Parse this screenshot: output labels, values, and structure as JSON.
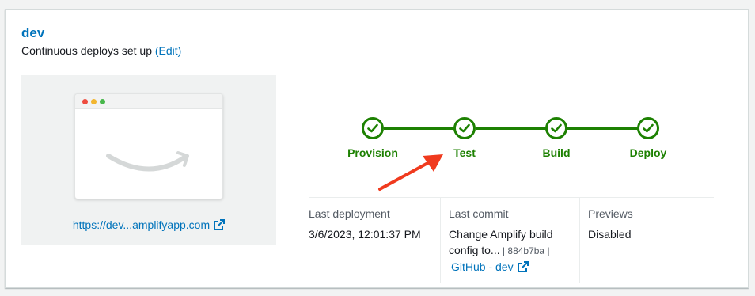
{
  "branch": {
    "name": "dev",
    "status_text": "Continuous deploys set up",
    "edit_label": "(Edit)"
  },
  "preview": {
    "url_label": "https://dev...amplifyapp.com"
  },
  "pipeline": {
    "steps": [
      {
        "label": "Provision",
        "status": "succeeded"
      },
      {
        "label": "Test",
        "status": "succeeded"
      },
      {
        "label": "Build",
        "status": "succeeded"
      },
      {
        "label": "Deploy",
        "status": "succeeded"
      }
    ]
  },
  "details": {
    "last_deployment": {
      "label": "Last deployment",
      "value": "3/6/2023, 12:01:37 PM"
    },
    "last_commit": {
      "label": "Last commit",
      "message_line1": "Change Amplify build",
      "message_line2": "config to...",
      "sep1": " | ",
      "hash": "884b7ba",
      "sep2": " |",
      "repo_link": "GitHub - dev"
    },
    "previews": {
      "label": "Previews",
      "value": "Disabled"
    }
  },
  "colors": {
    "link": "#0073bb",
    "success": "#1d8102",
    "annotation_arrow": "#f03a1e"
  }
}
